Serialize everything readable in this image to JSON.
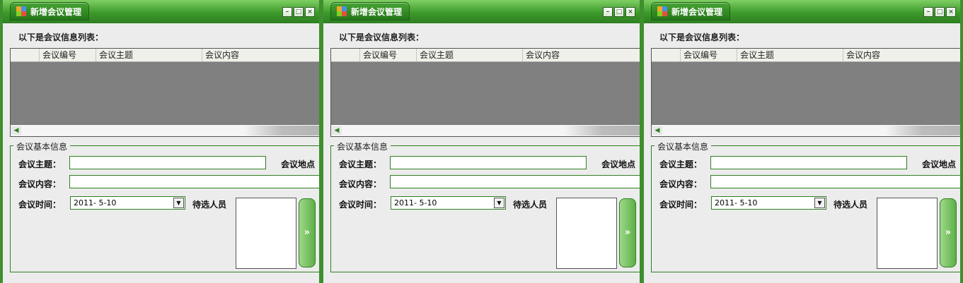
{
  "windows": [
    {
      "title": "新增会议管理",
      "list_caption": "以下是会议信息列表：",
      "columns": [
        "",
        "会议编号",
        "会议主题",
        "会议内容"
      ],
      "group_title": "会议基本信息",
      "subject_label": "会议主题：",
      "location_label": "会议地点",
      "content_label": "会议内容：",
      "time_label": "会议时间：",
      "date_value": "2011- 5-10",
      "candidates_label": "待选人员",
      "move_button": "»"
    },
    {
      "title": "新增会议管理",
      "list_caption": "以下是会议信息列表：",
      "columns": [
        "",
        "会议编号",
        "会议主题",
        "会议内容"
      ],
      "group_title": "会议基本信息",
      "subject_label": "会议主题：",
      "location_label": "会议地点",
      "content_label": "会议内容：",
      "time_label": "会议时间：",
      "date_value": "2011- 5-10",
      "candidates_label": "待选人员",
      "move_button": "»"
    },
    {
      "title": "新增会议管理",
      "list_caption": "以下是会议信息列表：",
      "columns": [
        "",
        "会议编号",
        "会议主题",
        "会议内容"
      ],
      "group_title": "会议基本信息",
      "subject_label": "会议主题：",
      "location_label": "会议地点",
      "content_label": "会议内容：",
      "time_label": "会议时间：",
      "date_value": "2011- 5-10",
      "candidates_label": "待选人员",
      "move_button": "»"
    }
  ],
  "colors": {
    "frame_green": "#3e8f2e",
    "title_gradient_top": "#7fcf63",
    "grid_body": "#808080",
    "panel_background": "#ececec"
  },
  "icons": {
    "app": "app-grid-icon",
    "minimize": "minimize-icon",
    "maximize": "maximize-icon",
    "close": "close-icon",
    "scroll_left": "scroll-left-arrow-icon",
    "dropdown": "chevron-down-icon"
  }
}
